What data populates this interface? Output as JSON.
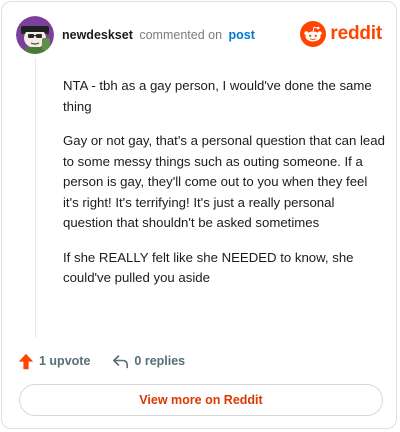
{
  "header": {
    "username": "newdeskset",
    "action_text": "commented on",
    "post_link_label": "post",
    "brand_name": "reddit",
    "brand_color": "#ff4500",
    "avatar_icon": "snoo-avatar-icon"
  },
  "comment": {
    "paragraphs": [
      "NTA - tbh as a gay person, I would've done the same thing",
      "Gay or not gay, that's a personal question that can lead to some messy things such as outing someone. If a person is gay, they'll come out to you when they feel it's right! It's terrifying! It's just a really personal question that shouldn't be asked sometimes",
      "If she REALLY felt like she NEEDED to know, she could've pulled you aside"
    ]
  },
  "footer": {
    "upvote_label": "1 upvote",
    "upvote_icon": "upvote-arrow-icon",
    "upvote_color": "#ff4500",
    "replies_label": "0 replies",
    "replies_icon": "reply-arrow-icon"
  },
  "cta": {
    "label": "View more on Reddit",
    "color": "#d93a00"
  }
}
